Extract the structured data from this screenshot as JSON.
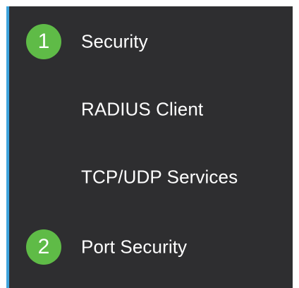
{
  "colors": {
    "panel_background": "#2e2e30",
    "accent_bar": "#3ea3dc",
    "step_badge": "#5fbb47",
    "text": "#ffffff"
  },
  "menu": {
    "items": [
      {
        "label": "Security",
        "step": "1"
      },
      {
        "label": "RADIUS Client"
      },
      {
        "label": "TCP/UDP Services"
      },
      {
        "label": "Port Security",
        "step": "2"
      }
    ]
  }
}
